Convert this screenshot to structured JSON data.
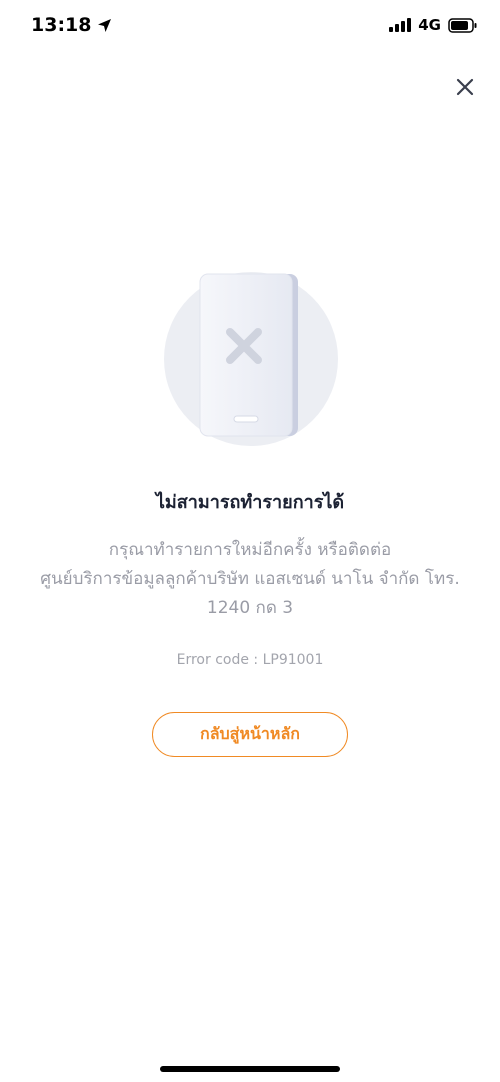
{
  "status_bar": {
    "time": "13:18",
    "network": "4G",
    "icons": [
      "location-arrow-icon",
      "signal-bars-icon",
      "battery-icon"
    ]
  },
  "close_icon": "close-icon",
  "illustration_icon": "phone-error-icon",
  "error": {
    "title": "ไม่สามารถทำรายการได้",
    "description_lines": [
      "กรุณาทำรายการใหม่อีกครั้ง หรือติดต่อ",
      "ศูนย์บริการข้อมูลลูกค้าบริษัท แอสเซนด์ นาโน จำกัด โทร.",
      "1240 กด 3"
    ],
    "code": "Error code : LP91001"
  },
  "actions": {
    "back_home_label": "กลับสู่หน้าหลัก"
  },
  "colors": {
    "accent": "#f08a24",
    "muted_text": "#9a9ca6",
    "illustration_bg": "#eceef3"
  }
}
